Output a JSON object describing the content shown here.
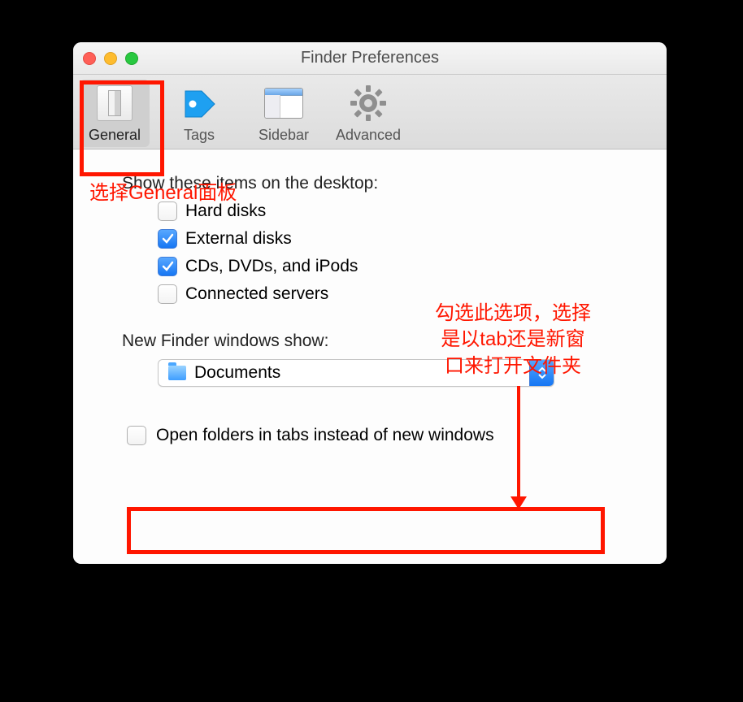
{
  "window": {
    "title": "Finder Preferences"
  },
  "tabs": {
    "t0": {
      "label": "General"
    },
    "t1": {
      "label": "Tags"
    },
    "t2": {
      "label": "Sidebar"
    },
    "t3": {
      "label": "Advanced"
    }
  },
  "desktop": {
    "heading": "Show these items on the desktop:",
    "items": [
      {
        "label": "Hard disks",
        "checked": false
      },
      {
        "label": "External disks",
        "checked": true
      },
      {
        "label": "CDs, DVDs, and iPods",
        "checked": true
      },
      {
        "label": "Connected servers",
        "checked": false
      }
    ]
  },
  "newfinder": {
    "heading": "New Finder windows show:",
    "selected": "Documents"
  },
  "open_tabs": {
    "label": "Open folders in tabs instead of new windows",
    "checked": false
  },
  "annotations": {
    "a1": "选择General面板",
    "a2_line1": "勾选此选项，选择",
    "a2_line2": "是以tab还是新窗",
    "a2_line3": "口来打开文件夹"
  }
}
